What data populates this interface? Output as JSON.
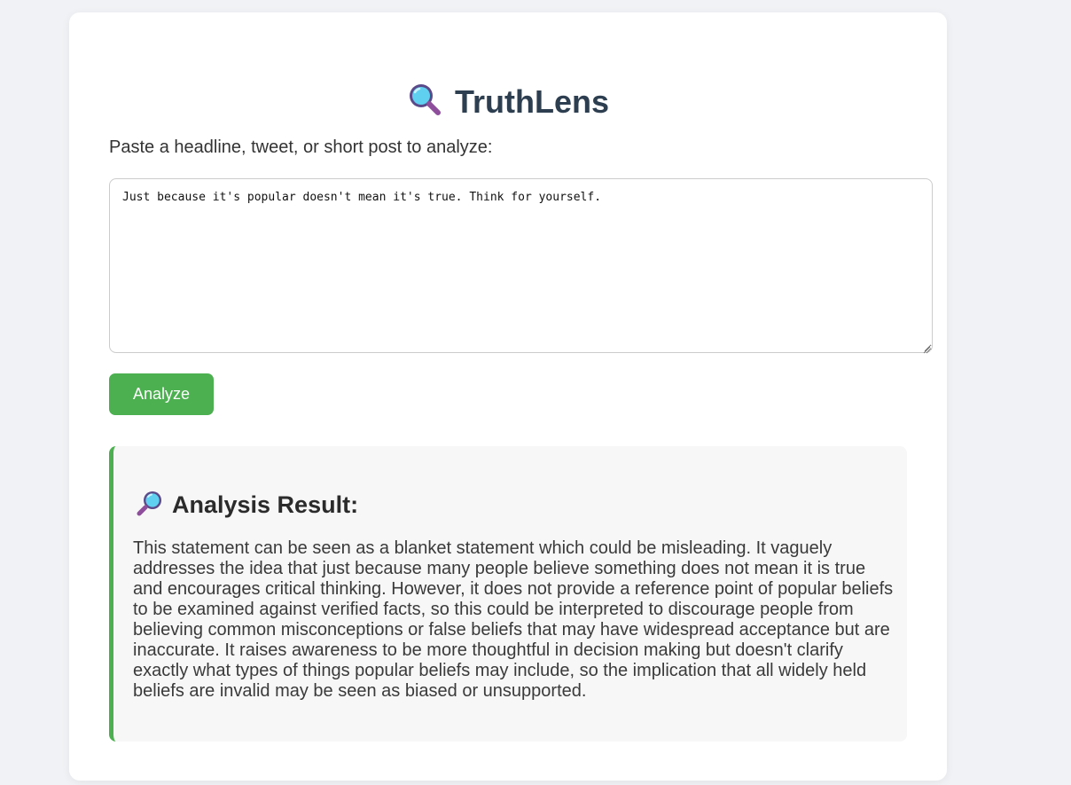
{
  "app": {
    "title": "TruthLens",
    "title_icon": "magnifying-glass-tilted-left-icon"
  },
  "input": {
    "label": "Paste a headline, tweet, or short post to analyze:",
    "value": "Just because it's popular doesn't mean it's true. Think for yourself.",
    "placeholder": ""
  },
  "actions": {
    "analyze_label": "Analyze"
  },
  "result": {
    "icon": "magnifying-glass-tilted-right-icon",
    "title": "Analysis Result:",
    "text": "This statement can be seen as a blanket statement which could be misleading. It vaguely addresses the idea that just because many people believe something does not mean it is true and encourages critical thinking. However, it does not provide a reference point of popular beliefs to be examined against verified facts, so this could be interpreted to discourage people from believing common misconceptions or false beliefs that may have widespread acceptance but are inaccurate. It raises awareness to be more thoughtful in decision making but doesn't clarify exactly what types of things popular beliefs may include, so the implication that all widely held beliefs are invalid may be seen as biased or unsupported."
  },
  "colors": {
    "background": "#f0f2f5",
    "card": "#ffffff",
    "title": "#2c3e50",
    "accent": "#4caf50",
    "result_bg": "#f7f7f7"
  }
}
